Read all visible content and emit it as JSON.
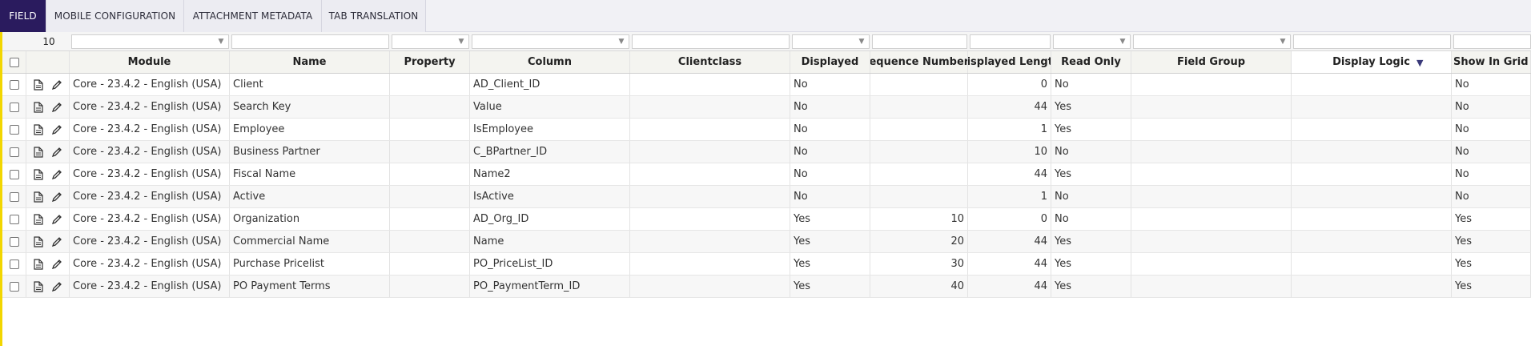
{
  "tabs": [
    {
      "label": "FIELD",
      "active": true
    },
    {
      "label": "MOBILE CONFIGURATION",
      "active": false
    },
    {
      "label": "ATTACHMENT METADATA",
      "active": false
    },
    {
      "label": "TAB TRANSLATION",
      "active": false
    }
  ],
  "grid": {
    "record_count": "10",
    "columns": {
      "module": "Module",
      "name": "Name",
      "property": "Property",
      "column": "Column",
      "clientclass": "Clientclass",
      "displayed": "Displayed",
      "sequence_number": "Sequence Number",
      "displayed_length": "Displayed Length",
      "read_only": "Read Only",
      "field_group": "Field Group",
      "display_logic": "Display Logic",
      "show_in_grid": "Show In Grid V"
    },
    "sort": {
      "column": "sequence_number",
      "direction": "ascending"
    },
    "rows": [
      {
        "module": "Core - 23.4.2 - English (USA)",
        "name": "Client",
        "property": "",
        "column": "AD_Client_ID",
        "clientclass": "",
        "displayed": "No",
        "sequence_number": "",
        "displayed_length": "0",
        "read_only": "No",
        "field_group": "",
        "display_logic": "",
        "show_in_grid": "No"
      },
      {
        "module": "Core - 23.4.2 - English (USA)",
        "name": "Search Key",
        "property": "",
        "column": "Value",
        "clientclass": "",
        "displayed": "No",
        "sequence_number": "",
        "displayed_length": "44",
        "read_only": "Yes",
        "field_group": "",
        "display_logic": "",
        "show_in_grid": "No"
      },
      {
        "module": "Core - 23.4.2 - English (USA)",
        "name": "Employee",
        "property": "",
        "column": "IsEmployee",
        "clientclass": "",
        "displayed": "No",
        "sequence_number": "",
        "displayed_length": "1",
        "read_only": "Yes",
        "field_group": "",
        "display_logic": "",
        "show_in_grid": "No"
      },
      {
        "module": "Core - 23.4.2 - English (USA)",
        "name": "Business Partner",
        "property": "",
        "column": "C_BPartner_ID",
        "clientclass": "",
        "displayed": "No",
        "sequence_number": "",
        "displayed_length": "10",
        "read_only": "No",
        "field_group": "",
        "display_logic": "",
        "show_in_grid": "No"
      },
      {
        "module": "Core - 23.4.2 - English (USA)",
        "name": "Fiscal Name",
        "property": "",
        "column": "Name2",
        "clientclass": "",
        "displayed": "No",
        "sequence_number": "",
        "displayed_length": "44",
        "read_only": "Yes",
        "field_group": "",
        "display_logic": "",
        "show_in_grid": "No"
      },
      {
        "module": "Core - 23.4.2 - English (USA)",
        "name": "Active",
        "property": "",
        "column": "IsActive",
        "clientclass": "",
        "displayed": "No",
        "sequence_number": "",
        "displayed_length": "1",
        "read_only": "No",
        "field_group": "",
        "display_logic": "",
        "show_in_grid": "No"
      },
      {
        "module": "Core - 23.4.2 - English (USA)",
        "name": "Organization",
        "property": "",
        "column": "AD_Org_ID",
        "clientclass": "",
        "displayed": "Yes",
        "sequence_number": "10",
        "displayed_length": "0",
        "read_only": "No",
        "field_group": "",
        "display_logic": "",
        "show_in_grid": "Yes"
      },
      {
        "module": "Core - 23.4.2 - English (USA)",
        "name": "Commercial Name",
        "property": "",
        "column": "Name",
        "clientclass": "",
        "displayed": "Yes",
        "sequence_number": "20",
        "displayed_length": "44",
        "read_only": "Yes",
        "field_group": "",
        "display_logic": "",
        "show_in_grid": "Yes"
      },
      {
        "module": "Core - 23.4.2 - English (USA)",
        "name": "Purchase Pricelist",
        "property": "",
        "column": "PO_PriceList_ID",
        "clientclass": "",
        "displayed": "Yes",
        "sequence_number": "30",
        "displayed_length": "44",
        "read_only": "Yes",
        "field_group": "",
        "display_logic": "",
        "show_in_grid": "Yes"
      },
      {
        "module": "Core - 23.4.2 - English (USA)",
        "name": "PO Payment Terms",
        "property": "",
        "column": "PO_PaymentTerm_ID",
        "clientclass": "",
        "displayed": "Yes",
        "sequence_number": "40",
        "displayed_length": "44",
        "read_only": "Yes",
        "field_group": "",
        "display_logic": "",
        "show_in_grid": "Yes"
      }
    ]
  },
  "colors": {
    "active_tab": "#2a1b5e",
    "left_stripe": "#f2d600"
  }
}
